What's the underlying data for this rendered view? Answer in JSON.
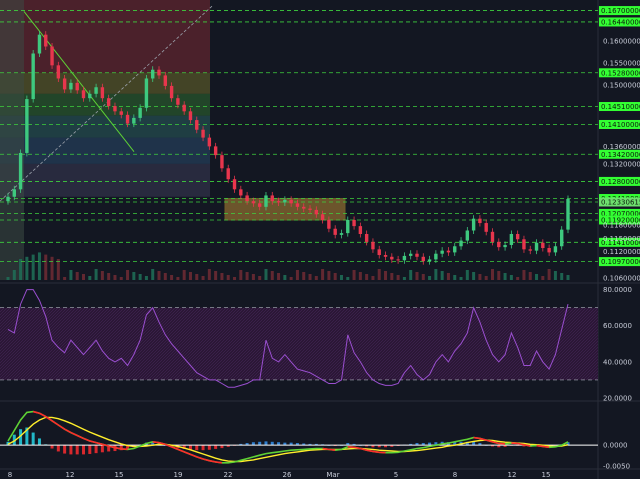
{
  "chart_data": [
    {
      "type": "candlestick",
      "panel": "price",
      "ylim": [
        0.1055,
        0.1685
      ],
      "x_ticks": [
        "8",
        "12",
        "15",
        "19",
        "22",
        "26",
        "Mar",
        "5",
        "8",
        "12",
        "15"
      ],
      "y_ticks": [
        "0.16000000",
        "0.15500000",
        "0.15000000",
        "0.13600000",
        "0.13200000",
        "0.11800000",
        "0.11500000",
        "0.11200000",
        "0.10600000"
      ],
      "horizontal_levels": [
        0.167,
        0.1644,
        0.1528,
        0.1451,
        0.141,
        0.1342,
        0.128,
        0.1241,
        0.12330615,
        0.1207,
        0.1192,
        0.1141,
        0.1097
      ],
      "level_labels": [
        "0.16700000",
        "0.16440000",
        "0.15280000",
        "0.14510000",
        "0.14100000",
        "0.13420000",
        "0.12800000",
        "0.12410000",
        "0.12330615",
        "0.12070000",
        "0.11920000",
        "0.11410000",
        "0.10970000"
      ],
      "close_series": [
        0.1245,
        0.1262,
        0.1345,
        0.1468,
        0.1572,
        0.1615,
        0.1588,
        0.1545,
        0.1515,
        0.149,
        0.1505,
        0.1488,
        0.147,
        0.148,
        0.1495,
        0.147,
        0.1452,
        0.144,
        0.1432,
        0.1412,
        0.1425,
        0.1448,
        0.1515,
        0.1535,
        0.1522,
        0.1498,
        0.147,
        0.1455,
        0.144,
        0.142,
        0.1398,
        0.138,
        0.136,
        0.134,
        0.131,
        0.1285,
        0.1262,
        0.1248,
        0.1235,
        0.123,
        0.1222,
        0.1248,
        0.1235,
        0.1232,
        0.1238,
        0.123,
        0.1222,
        0.1218,
        0.1215,
        0.1205,
        0.1192,
        0.1172,
        0.1158,
        0.1162,
        0.1192,
        0.1178,
        0.116,
        0.1142,
        0.1125,
        0.1112,
        0.1108,
        0.1102,
        0.11,
        0.111,
        0.1115,
        0.1108,
        0.1098,
        0.1102,
        0.1115,
        0.1122,
        0.1118,
        0.1132,
        0.1145,
        0.1168,
        0.1195,
        0.1185,
        0.1165,
        0.1142,
        0.113,
        0.1135,
        0.116,
        0.1148,
        0.1125,
        0.1122,
        0.114,
        0.1128,
        0.1118,
        0.1132,
        0.117,
        0.124
      ]
    },
    {
      "type": "line",
      "panel": "rsi",
      "ylim": [
        20,
        82
      ],
      "y_ticks": [
        "80.0000",
        "60.0000",
        "40.0000",
        "20.0000"
      ],
      "bands": [
        30,
        70
      ],
      "values": [
        58,
        56,
        72,
        80,
        80,
        74,
        65,
        52,
        48,
        45,
        52,
        48,
        44,
        48,
        52,
        46,
        42,
        40,
        42,
        38,
        44,
        52,
        66,
        70,
        62,
        55,
        50,
        46,
        42,
        38,
        34,
        32,
        30,
        30,
        28,
        26,
        26,
        27,
        28,
        30,
        30,
        52,
        42,
        40,
        44,
        40,
        36,
        35,
        34,
        32,
        30,
        28,
        28,
        30,
        55,
        45,
        40,
        34,
        30,
        28,
        27,
        27,
        28,
        34,
        38,
        33,
        30,
        33,
        40,
        44,
        40,
        46,
        50,
        56,
        70,
        62,
        52,
        44,
        40,
        44,
        56,
        48,
        38,
        38,
        46,
        40,
        36,
        44,
        58,
        72
      ]
    },
    {
      "type": "line",
      "panel": "macd",
      "ylim": [
        -0.0052,
        0.0098
      ],
      "y_ticks": [
        "0.0000",
        "-0.0050"
      ],
      "series_colors": [
        "#5ed235",
        "#ff2a2a",
        "#ffee2a"
      ],
      "macd": [
        0.001,
        0.0035,
        0.006,
        0.0078,
        0.008,
        0.0076,
        0.0068,
        0.0058,
        0.0048,
        0.0038,
        0.003,
        0.0023,
        0.0016,
        0.001,
        0.0006,
        0.0002,
        -0.0002,
        -0.0006,
        -0.0009,
        -0.001,
        -0.0008,
        -0.0002,
        0.0004,
        0.0008,
        0.0006,
        0.0002,
        -0.0004,
        -0.001,
        -0.0016,
        -0.0022,
        -0.0028,
        -0.0033,
        -0.0037,
        -0.004,
        -0.0042,
        -0.0042,
        -0.004,
        -0.0036,
        -0.0032,
        -0.0028,
        -0.0024,
        -0.002,
        -0.0018,
        -0.0016,
        -0.0014,
        -0.0012,
        -0.0011,
        -0.001,
        -0.0009,
        -0.0008,
        -0.0008,
        -0.001,
        -0.0012,
        -0.001,
        -0.0004,
        -0.0005,
        -0.0008,
        -0.0012,
        -0.0015,
        -0.0017,
        -0.0018,
        -0.0018,
        -0.0017,
        -0.0014,
        -0.0011,
        -0.0008,
        -0.0006,
        -0.0003,
        0.0,
        0.0003,
        0.0005,
        0.0008,
        0.0011,
        0.0014,
        0.0018,
        0.0016,
        0.0012,
        0.0008,
        0.0004,
        0.0003,
        0.0005,
        0.0004,
        0.0001,
        -0.0002,
        -0.0001,
        -0.0003,
        -0.0005,
        -0.0004,
        0.0,
        0.0008
      ],
      "signal": [
        0.0002,
        0.001,
        0.0022,
        0.0036,
        0.005,
        0.006,
        0.0066,
        0.0066,
        0.0063,
        0.0058,
        0.0052,
        0.0045,
        0.0038,
        0.0031,
        0.0025,
        0.0019,
        0.0013,
        0.0008,
        0.0003,
        -0.0001,
        -0.0003,
        -0.0003,
        -0.0002,
        0.0,
        0.0002,
        0.0002,
        0.0,
        -0.0003,
        -0.0007,
        -0.0011,
        -0.0016,
        -0.0021,
        -0.0026,
        -0.0031,
        -0.0035,
        -0.0038,
        -0.0039,
        -0.0039,
        -0.0037,
        -0.0035,
        -0.0032,
        -0.0029,
        -0.0026,
        -0.0023,
        -0.002,
        -0.0018,
        -0.0016,
        -0.0014,
        -0.0012,
        -0.0011,
        -0.001,
        -0.001,
        -0.001,
        -0.001,
        -0.0009,
        -0.0008,
        -0.0008,
        -0.0009,
        -0.001,
        -0.0012,
        -0.0013,
        -0.0014,
        -0.0015,
        -0.0015,
        -0.0014,
        -0.0013,
        -0.0011,
        -0.0009,
        -0.0007,
        -0.0005,
        -0.0002,
        0.0,
        0.0003,
        0.0006,
        0.0009,
        0.0011,
        0.0012,
        0.0011,
        0.0009,
        0.0007,
        0.0006,
        0.0005,
        0.0004,
        0.0002,
        0.0001,
        0.0,
        -0.0002,
        -0.0003,
        -0.0002,
        0.0001
      ]
    }
  ],
  "colors": {
    "background": "#131722",
    "up": "#3ec97f",
    "down": "#e8364d",
    "rsi_line": "#9a4fd0",
    "level_line": "#3ed13e",
    "level_box": "#33ff33",
    "volume": "#2e7a5c",
    "label": "#c8ccd8"
  }
}
